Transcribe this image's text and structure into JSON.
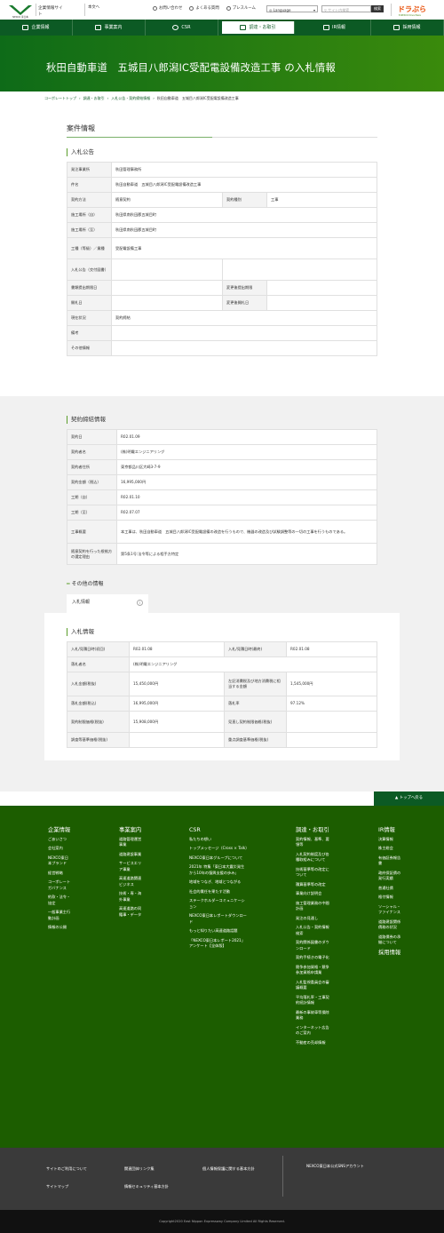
{
  "header": {
    "logo_text": "NEXCO 東日本",
    "site_name": "企業情報サイト",
    "home_link": "本文へ",
    "links": [
      "お問い合わせ",
      "よくある質問",
      "プレスルーム"
    ],
    "language": "Language",
    "search_placeholder": "サイト内検索",
    "search_button": "検索",
    "drapura": "ドラぷら",
    "drapura_sub": "E-NEXCO Drive Plaza"
  },
  "nav": [
    {
      "label": "企業情報",
      "icon": "building-icon"
    },
    {
      "label": "事業案内",
      "icon": "road-icon"
    },
    {
      "label": "CSR",
      "icon": "heart-icon"
    },
    {
      "label": "調達・お取引",
      "icon": "handshake-icon",
      "active": true
    },
    {
      "label": "IR情報",
      "icon": "document-icon"
    },
    {
      "label": "採用情報",
      "icon": "people-icon"
    }
  ],
  "page_title": "秋田自動車道　五城目八郎潟IC受配電設備改造工事 の入札情報",
  "breadcrumb": [
    "コーポレートトップ",
    "調達・お取引",
    "入札公告・契約締結情報",
    "秋田自動車道　五城目八郎潟IC受配電設備改造工事"
  ],
  "section_title": "案件情報",
  "notice": {
    "title": "入札公告",
    "rows": [
      {
        "label": "発注事業所",
        "value": "秋田管理事務所"
      },
      {
        "label": "件名",
        "value": "秋田自動車道　五城目八郎潟IC受配電設備改造工事"
      },
      {
        "label": "契約方法",
        "value": "随意契約",
        "label2": "契約種別",
        "value2": "工事"
      },
      {
        "label": "施工場所（自）",
        "value": "秋田県南秋田郡五城目町"
      },
      {
        "label": "施工場所（至）",
        "value": "秋田県南秋田郡五城目町"
      },
      {
        "label": "工種（等級）／業種",
        "value": "受配電設備工事"
      },
      {
        "label": "入札公告（交付図書）",
        "value": ""
      },
      {
        "label": "書類提出期限日",
        "value": "",
        "label2": "変更後提出期限",
        "value2": ""
      },
      {
        "label": "開札日",
        "value": "",
        "label2": "変更後開札日",
        "value2": ""
      },
      {
        "label": "現在状況",
        "value": "契約締結"
      },
      {
        "label": "備考",
        "value": ""
      },
      {
        "label": "その他情報",
        "value": ""
      }
    ]
  },
  "contract": {
    "title": "契約締結情報",
    "rows": [
      {
        "label": "契約日",
        "value": "R02.01.09"
      },
      {
        "label": "契約者名",
        "value": "(株)明電エンジニアリング"
      },
      {
        "label": "契約者住所",
        "value": "東京都品川区大崎3-7-9"
      },
      {
        "label": "契約金額（税込）",
        "value": "16,995,000円"
      },
      {
        "label": "工期（自）",
        "value": "R02.01.10"
      },
      {
        "label": "工期（至）",
        "value": "R02.07.07"
      },
      {
        "label": "工事概要",
        "value": "本工事は、秋田自動車道　五城目八郎潟IC受配電設備の改造を行うもので、機器の改造及び試験調整等の一切の工事を行うものである。"
      },
      {
        "label": "随意契約を行った根拠方の選定理由",
        "value": "第5条1号:法令等による相手方特定"
      }
    ]
  },
  "other": {
    "title": "その他の情報",
    "tab_label": "入札情報",
    "tab_icon": "i"
  },
  "bid": {
    "title": "入札情報",
    "rows": [
      {
        "label": "入札/見積日時(初回)",
        "value": "R02.01.08",
        "label2": "入札/見積日時(最終)",
        "value2": "R02.01.08"
      },
      {
        "label": "落札者名",
        "value": "(株)明電エンジニアリング"
      },
      {
        "label": "入札金額(税抜)",
        "value": "15,450,000円",
        "label2": "左記消費税及び地方消費税に相当する金額",
        "value2": "1,545,000円"
      },
      {
        "label": "落札金額(税込)",
        "value": "16,995,000円",
        "label2": "落札率",
        "value2": "97.12%"
      },
      {
        "label": "契約制限価格(税抜)",
        "value": "15,908,000円",
        "label2": "見直し契約制限価格(税抜)",
        "value2": ""
      },
      {
        "label": "調査等基準価格(税抜)",
        "value": "",
        "label2": "重点調査基準価格(税抜)",
        "value2": ""
      }
    ]
  },
  "to_top": "トップへ戻る",
  "footer": {
    "cols": [
      {
        "head": "企業情報",
        "items": [
          "ごあいさつ",
          "会社案内",
          "NEXCO東日本ブランド",
          "経営戦略",
          "コーポレートガバナンス",
          "約款・法令・協定",
          "一般事業主行動計画",
          "情報の公開"
        ]
      },
      {
        "head": "事業案内",
        "items": [
          "道路管理運営事業",
          "道路建設事業",
          "サービスエリア事業",
          "高速道路関連ビジネス",
          "技術・専・海外事業",
          "高速道路の同籍事・データ"
        ]
      },
      {
        "head": "CSR",
        "items": [
          "私たちの想い",
          "トップメッセージ（Cross × Talk）",
          "NEXCO東日本グループについて",
          "2021年 特集「東日本大震災発生から10年の復興支援の歩み」",
          "地域をつなぎ、地域とつながる",
          "社会的責任を果たす活動",
          "ステークホルダーコミュニケーション",
          "NEXCO東日本レポートダウンロード",
          "もっと知りたい高速道路話題",
          "「NEXCO東日本レポート2021」アンケート【全体版】"
        ]
      },
      {
        "head": "調達・お取引",
        "items": [
          "契約情報、基準、要領等",
          "入札契約制度及び各種取組みについて",
          "技術基準等の改定について",
          "積算基準等の改定",
          "事業向け説明会",
          "施工管理業務の中間計画",
          "発注の見通し",
          "入札公告・契約情報検索",
          "契約関係図書のダウンロード",
          "契約手続きの電子化",
          "競争参加資格・競争参加資格申請業",
          "入札監視委員会の審議概要",
          "平均落札率・工事契約続計情報",
          "最新の事故車等損除業務",
          "インターネット広告のご案内",
          "不動産の売却情報"
        ]
      },
      {
        "head": "IR情報",
        "items": [
          "決算情報",
          "株主総会",
          "有価証券報告書",
          "政府保証債の発行実績",
          "普通社債",
          "格付情報",
          "ソーシャル・ファイナンス",
          "道路建設関係債務の状況",
          "道路債券の承継について"
        ]
      },
      {
        "head": "採用情報",
        "items": []
      }
    ]
  },
  "footbot": {
    "links": [
      "サイトのご利用について",
      "関連団体リンク集",
      "個人情報保護に関する基本方針",
      "サイトマップ",
      "情報セキュリティ基本方針"
    ],
    "sns": "NEXCO東日本公式SNSアカウント"
  },
  "copyright": "Copyright2020 East Nippon Expressway Company Limited All Rights Reserved."
}
